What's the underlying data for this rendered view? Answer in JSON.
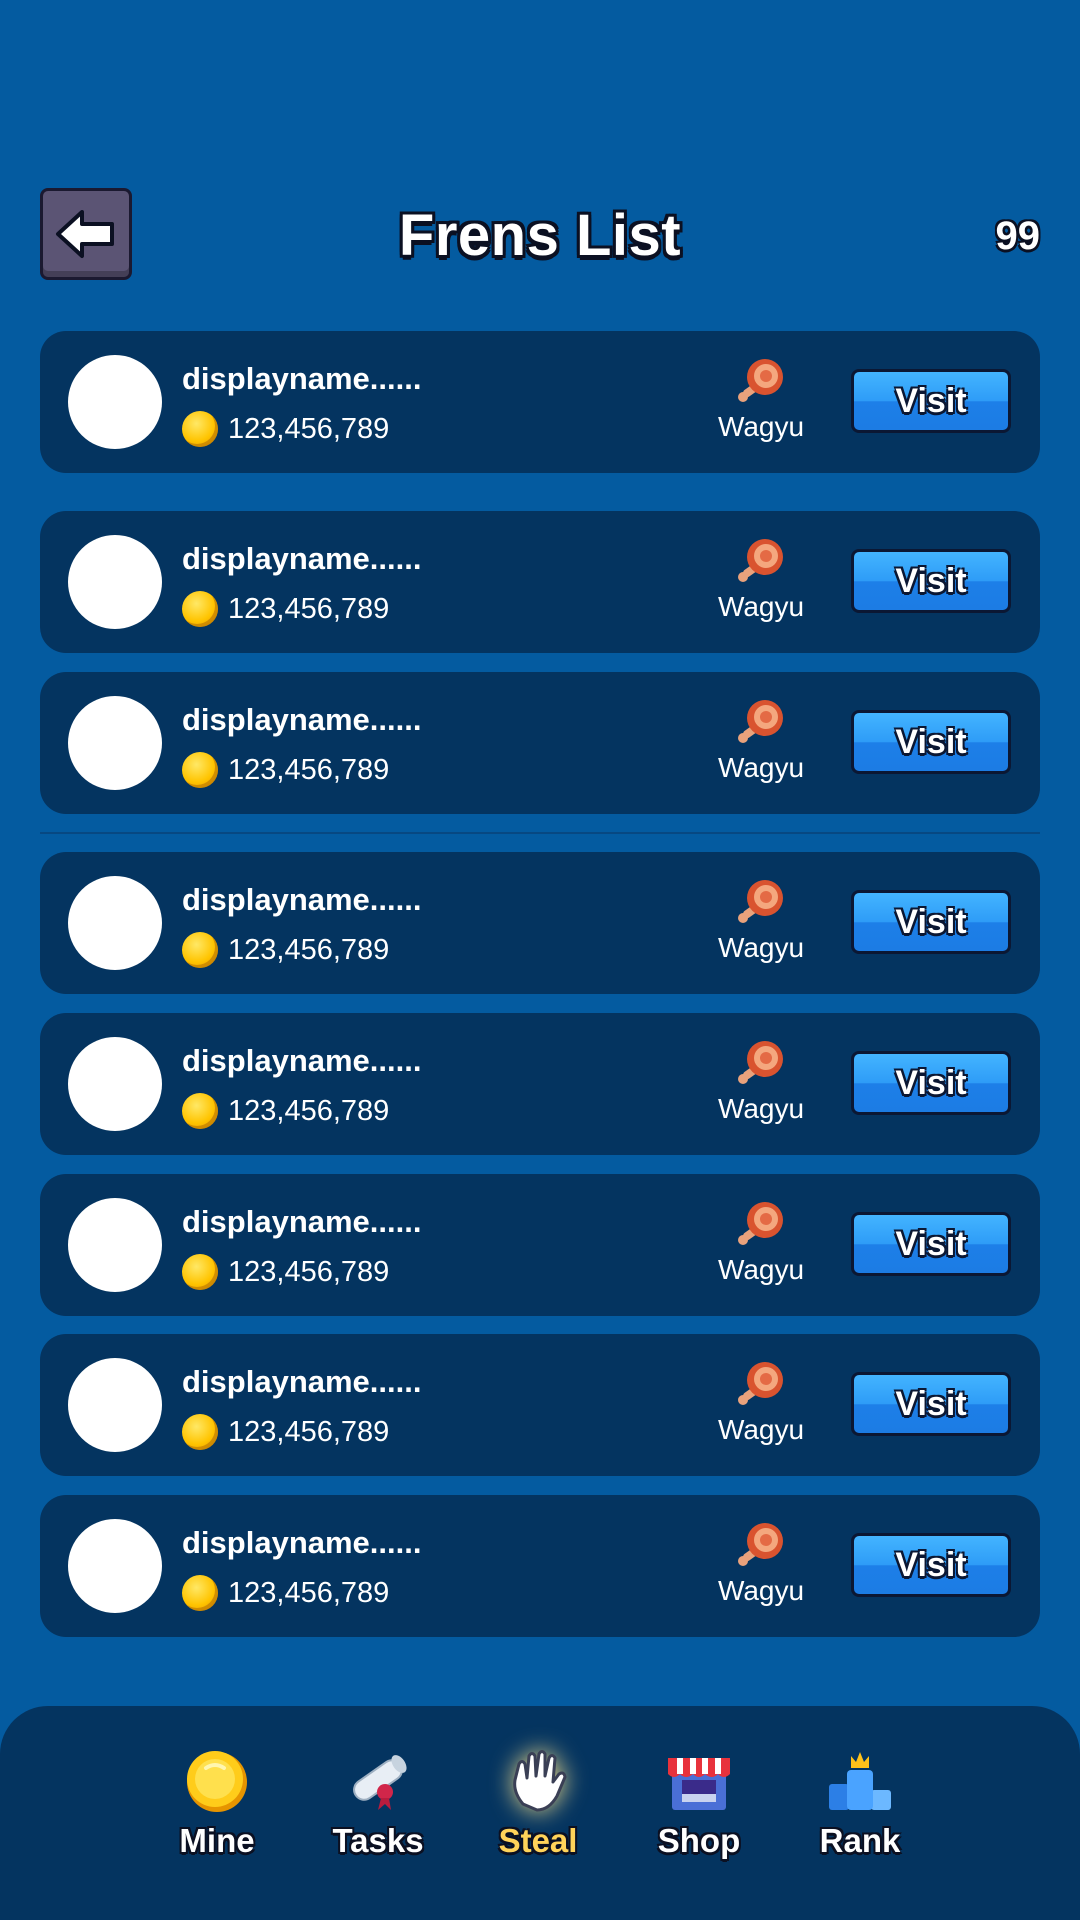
{
  "header": {
    "title": "Frens List",
    "count": "99"
  },
  "friends": [
    {
      "name": "displayname......",
      "coins": "123,456,789",
      "item": "Wagyu",
      "action": "Visit"
    },
    {
      "name": "displayname......",
      "coins": "123,456,789",
      "item": "Wagyu",
      "action": "Visit"
    },
    {
      "name": "displayname......",
      "coins": "123,456,789",
      "item": "Wagyu",
      "action": "Visit"
    },
    {
      "name": "displayname......",
      "coins": "123,456,789",
      "item": "Wagyu",
      "action": "Visit"
    },
    {
      "name": "displayname......",
      "coins": "123,456,789",
      "item": "Wagyu",
      "action": "Visit"
    },
    {
      "name": "displayname......",
      "coins": "123,456,789",
      "item": "Wagyu",
      "action": "Visit"
    },
    {
      "name": "displayname......",
      "coins": "123,456,789",
      "item": "Wagyu",
      "action": "Visit"
    },
    {
      "name": "displayname......",
      "coins": "123,456,789",
      "item": "Wagyu",
      "action": "Visit"
    }
  ],
  "nav": {
    "items": [
      {
        "label": "Mine",
        "icon": "coin-icon"
      },
      {
        "label": "Tasks",
        "icon": "scroll-icon"
      },
      {
        "label": "Steal",
        "icon": "hand-icon",
        "active": true
      },
      {
        "label": "Shop",
        "icon": "shop-icon"
      },
      {
        "label": "Rank",
        "icon": "trophy-icon"
      }
    ]
  },
  "colors": {
    "background": "#045ba0",
    "row": "#043460",
    "visit_button": "#2e9cf7",
    "active_nav": "#ffd35a"
  }
}
